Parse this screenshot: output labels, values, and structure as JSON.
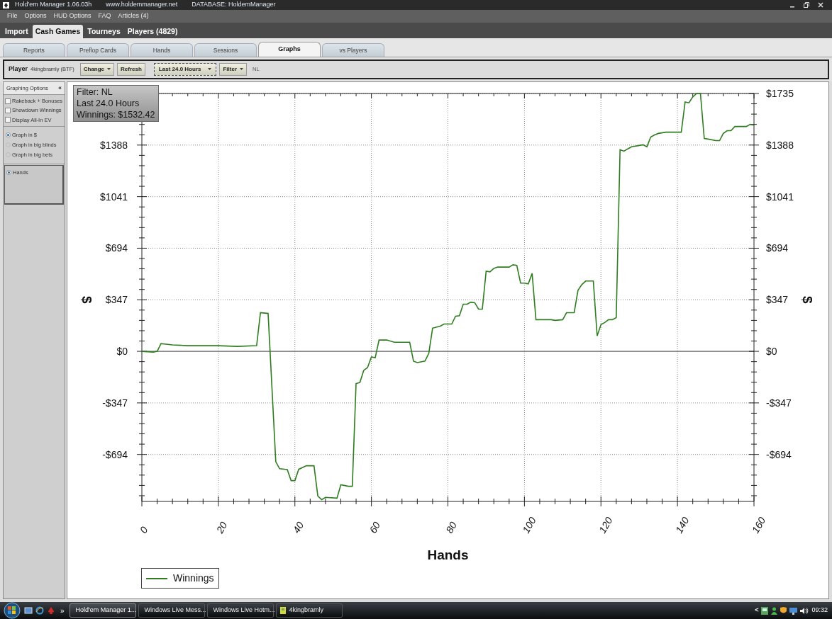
{
  "title_bar": {
    "title": "Hold'em Manager 1.06.03h",
    "website": "www.holdemmanager.net",
    "database": "DATABASE: HoldemManager"
  },
  "menu": [
    "File",
    "Options",
    "HUD Options",
    "FAQ",
    "Articles (4)"
  ],
  "main_tabs": [
    {
      "label": "Import",
      "selected": false
    },
    {
      "label": "Cash Games",
      "selected": true
    },
    {
      "label": "Tourneys",
      "selected": false
    },
    {
      "label": "Players (4829)",
      "selected": false
    }
  ],
  "sub_tabs": [
    {
      "label": "Reports",
      "selected": false
    },
    {
      "label": "Preflop Cards",
      "selected": false
    },
    {
      "label": "Hands",
      "selected": false
    },
    {
      "label": "Sessions",
      "selected": false
    },
    {
      "label": "Graphs",
      "selected": true
    },
    {
      "label": "vs Players",
      "selected": false
    }
  ],
  "player_bar": {
    "label": "Player",
    "player": "4kingbramly (BTF)",
    "buttons": [
      {
        "label": "Change",
        "kind": "dropdown"
      },
      {
        "label": "Refresh",
        "kind": "plain"
      },
      {
        "label": "Last 24.0 Hours",
        "kind": "period"
      },
      {
        "label": "Filter",
        "kind": "dropdown"
      }
    ],
    "filter_value": "NL"
  },
  "graphing_options": {
    "title": "Graphing Options",
    "collapse": "«",
    "checkboxes": [
      {
        "label": "Rakeback + Bonuses",
        "checked": false
      },
      {
        "label": "Showdown Winnings",
        "checked": false
      },
      {
        "label": "Display All-In EV",
        "checked": false
      }
    ],
    "units": [
      {
        "label": "Graph in $",
        "selected": true
      },
      {
        "label": "Graph in big blinds",
        "selected": false
      },
      {
        "label": "Graph in big bets",
        "selected": false
      }
    ],
    "x_axis": [
      {
        "label": "Hands",
        "selected": true
      }
    ]
  },
  "info_box": [
    "Filter: NL",
    "Last 24.0 Hours",
    "Winnings: $1532.42"
  ],
  "chart_data": {
    "type": "line",
    "xlabel": "Hands",
    "ylabel": "$",
    "xlim": [
      0,
      160
    ],
    "ylim": [
      -1010,
      1735
    ],
    "grid": true,
    "xticks": [
      0,
      20,
      40,
      60,
      80,
      100,
      120,
      140,
      160
    ],
    "yticks": [
      {
        "value": 1735,
        "label": "$1735"
      },
      {
        "value": 1388,
        "label": "$1388"
      },
      {
        "value": 1041,
        "label": "$1041"
      },
      {
        "value": 694,
        "label": "$694"
      },
      {
        "value": 347,
        "label": "$347"
      },
      {
        "value": 0,
        "label": "$0"
      },
      {
        "value": -347,
        "label": "-$347"
      },
      {
        "value": -694,
        "label": "-$694"
      }
    ],
    "x": [
      0,
      3,
      4,
      5,
      8,
      12,
      20,
      25,
      30,
      31,
      33,
      35,
      36,
      38,
      39,
      40,
      41,
      43,
      45,
      46,
      47,
      48,
      51,
      52,
      54,
      55,
      56,
      57,
      58,
      59,
      60,
      61,
      62,
      64,
      66,
      70,
      71,
      72,
      74,
      75,
      76,
      78,
      79,
      81,
      82,
      83,
      84,
      85,
      86,
      87,
      88,
      89,
      90,
      91,
      92,
      93,
      96,
      97,
      98,
      99,
      100,
      101,
      102,
      103,
      107,
      108,
      110,
      111,
      113,
      114,
      115,
      116,
      118,
      119,
      120,
      121,
      122,
      123,
      124,
      125,
      126,
      127,
      128,
      130,
      131,
      132,
      133,
      134,
      135,
      137,
      141,
      142,
      143,
      144,
      145,
      146,
      147,
      148,
      150,
      151,
      152,
      153,
      154,
      155,
      158,
      159,
      160
    ],
    "series": [
      {
        "name": "Winnings",
        "color": "#2e7d1e",
        "values": [
          0,
          -5,
          0,
          52,
          43,
          38,
          38,
          33,
          38,
          260,
          255,
          -742,
          -790,
          -795,
          -870,
          -870,
          -794,
          -770,
          -770,
          -974,
          -998,
          -983,
          -988,
          -898,
          -908,
          -908,
          -217,
          -210,
          -128,
          -109,
          -38,
          -43,
          76,
          76,
          61,
          61,
          -66,
          -76,
          -66,
          -14,
          156,
          170,
          184,
          184,
          236,
          240,
          317,
          317,
          331,
          327,
          284,
          284,
          539,
          535,
          558,
          567,
          567,
          582,
          578,
          459,
          459,
          454,
          525,
          213,
          213,
          208,
          213,
          260,
          260,
          411,
          449,
          473,
          473,
          104,
          180,
          194,
          213,
          213,
          227,
          1357,
          1347,
          1362,
          1376,
          1385,
          1390,
          1376,
          1442,
          1456,
          1466,
          1475,
          1475,
          1678,
          1672,
          1712,
          1735,
          1735,
          1432,
          1428,
          1418,
          1418,
          1466,
          1485,
          1485,
          1513,
          1513,
          1527,
          1522
        ]
      }
    ]
  },
  "taskbar": {
    "overflow": "»",
    "tasks": [
      {
        "label": "Hold'em Manager 1...",
        "selected": true
      },
      {
        "label": "Windows Live Mess...",
        "selected": false
      },
      {
        "label": "Windows Live Hotm...",
        "selected": false
      },
      {
        "label": "4kingbramly",
        "selected": false
      }
    ],
    "tray_arrow": "<",
    "clock": "09:32"
  }
}
